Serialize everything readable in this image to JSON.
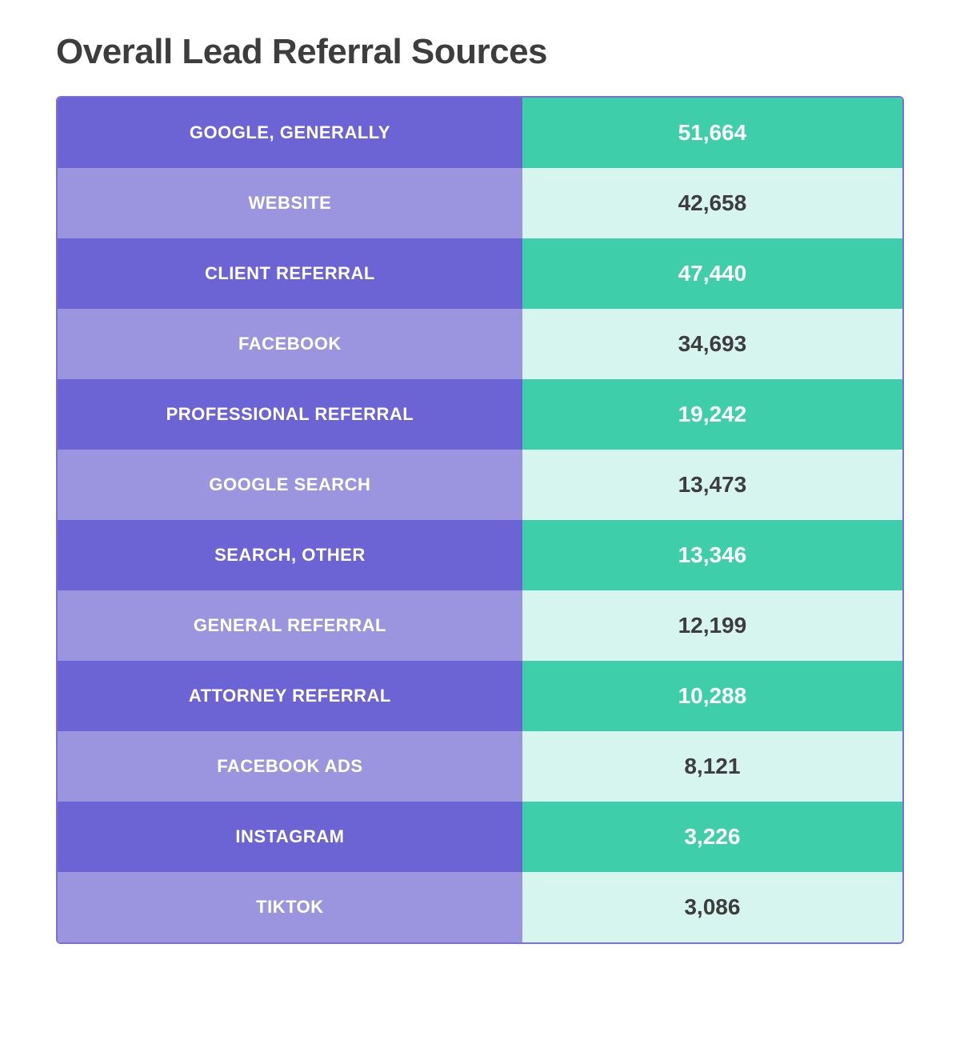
{
  "page": {
    "title": "Overall Lead Referral Sources"
  },
  "rows": [
    {
      "label": "GOOGLE, GENERALLY",
      "value": "51,664",
      "type": "dark"
    },
    {
      "label": "WEBSITE",
      "value": "42,658",
      "type": "light"
    },
    {
      "label": "CLIENT REFERRAL",
      "value": "47,440",
      "type": "dark"
    },
    {
      "label": "FACEBOOK",
      "value": "34,693",
      "type": "light"
    },
    {
      "label": "PROFESSIONAL REFERRAL",
      "value": "19,242",
      "type": "dark"
    },
    {
      "label": "GOOGLE SEARCH",
      "value": "13,473",
      "type": "light"
    },
    {
      "label": "SEARCH, OTHER",
      "value": "13,346",
      "type": "dark"
    },
    {
      "label": "GENERAL REFERRAL",
      "value": "12,199",
      "type": "light"
    },
    {
      "label": "ATTORNEY REFERRAL",
      "value": "10,288",
      "type": "dark"
    },
    {
      "label": "FACEBOOK ADS",
      "value": "8,121",
      "type": "light"
    },
    {
      "label": "INSTAGRAM",
      "value": "3,226",
      "type": "dark"
    },
    {
      "label": "TIKTOK",
      "value": "3,086",
      "type": "light"
    }
  ]
}
